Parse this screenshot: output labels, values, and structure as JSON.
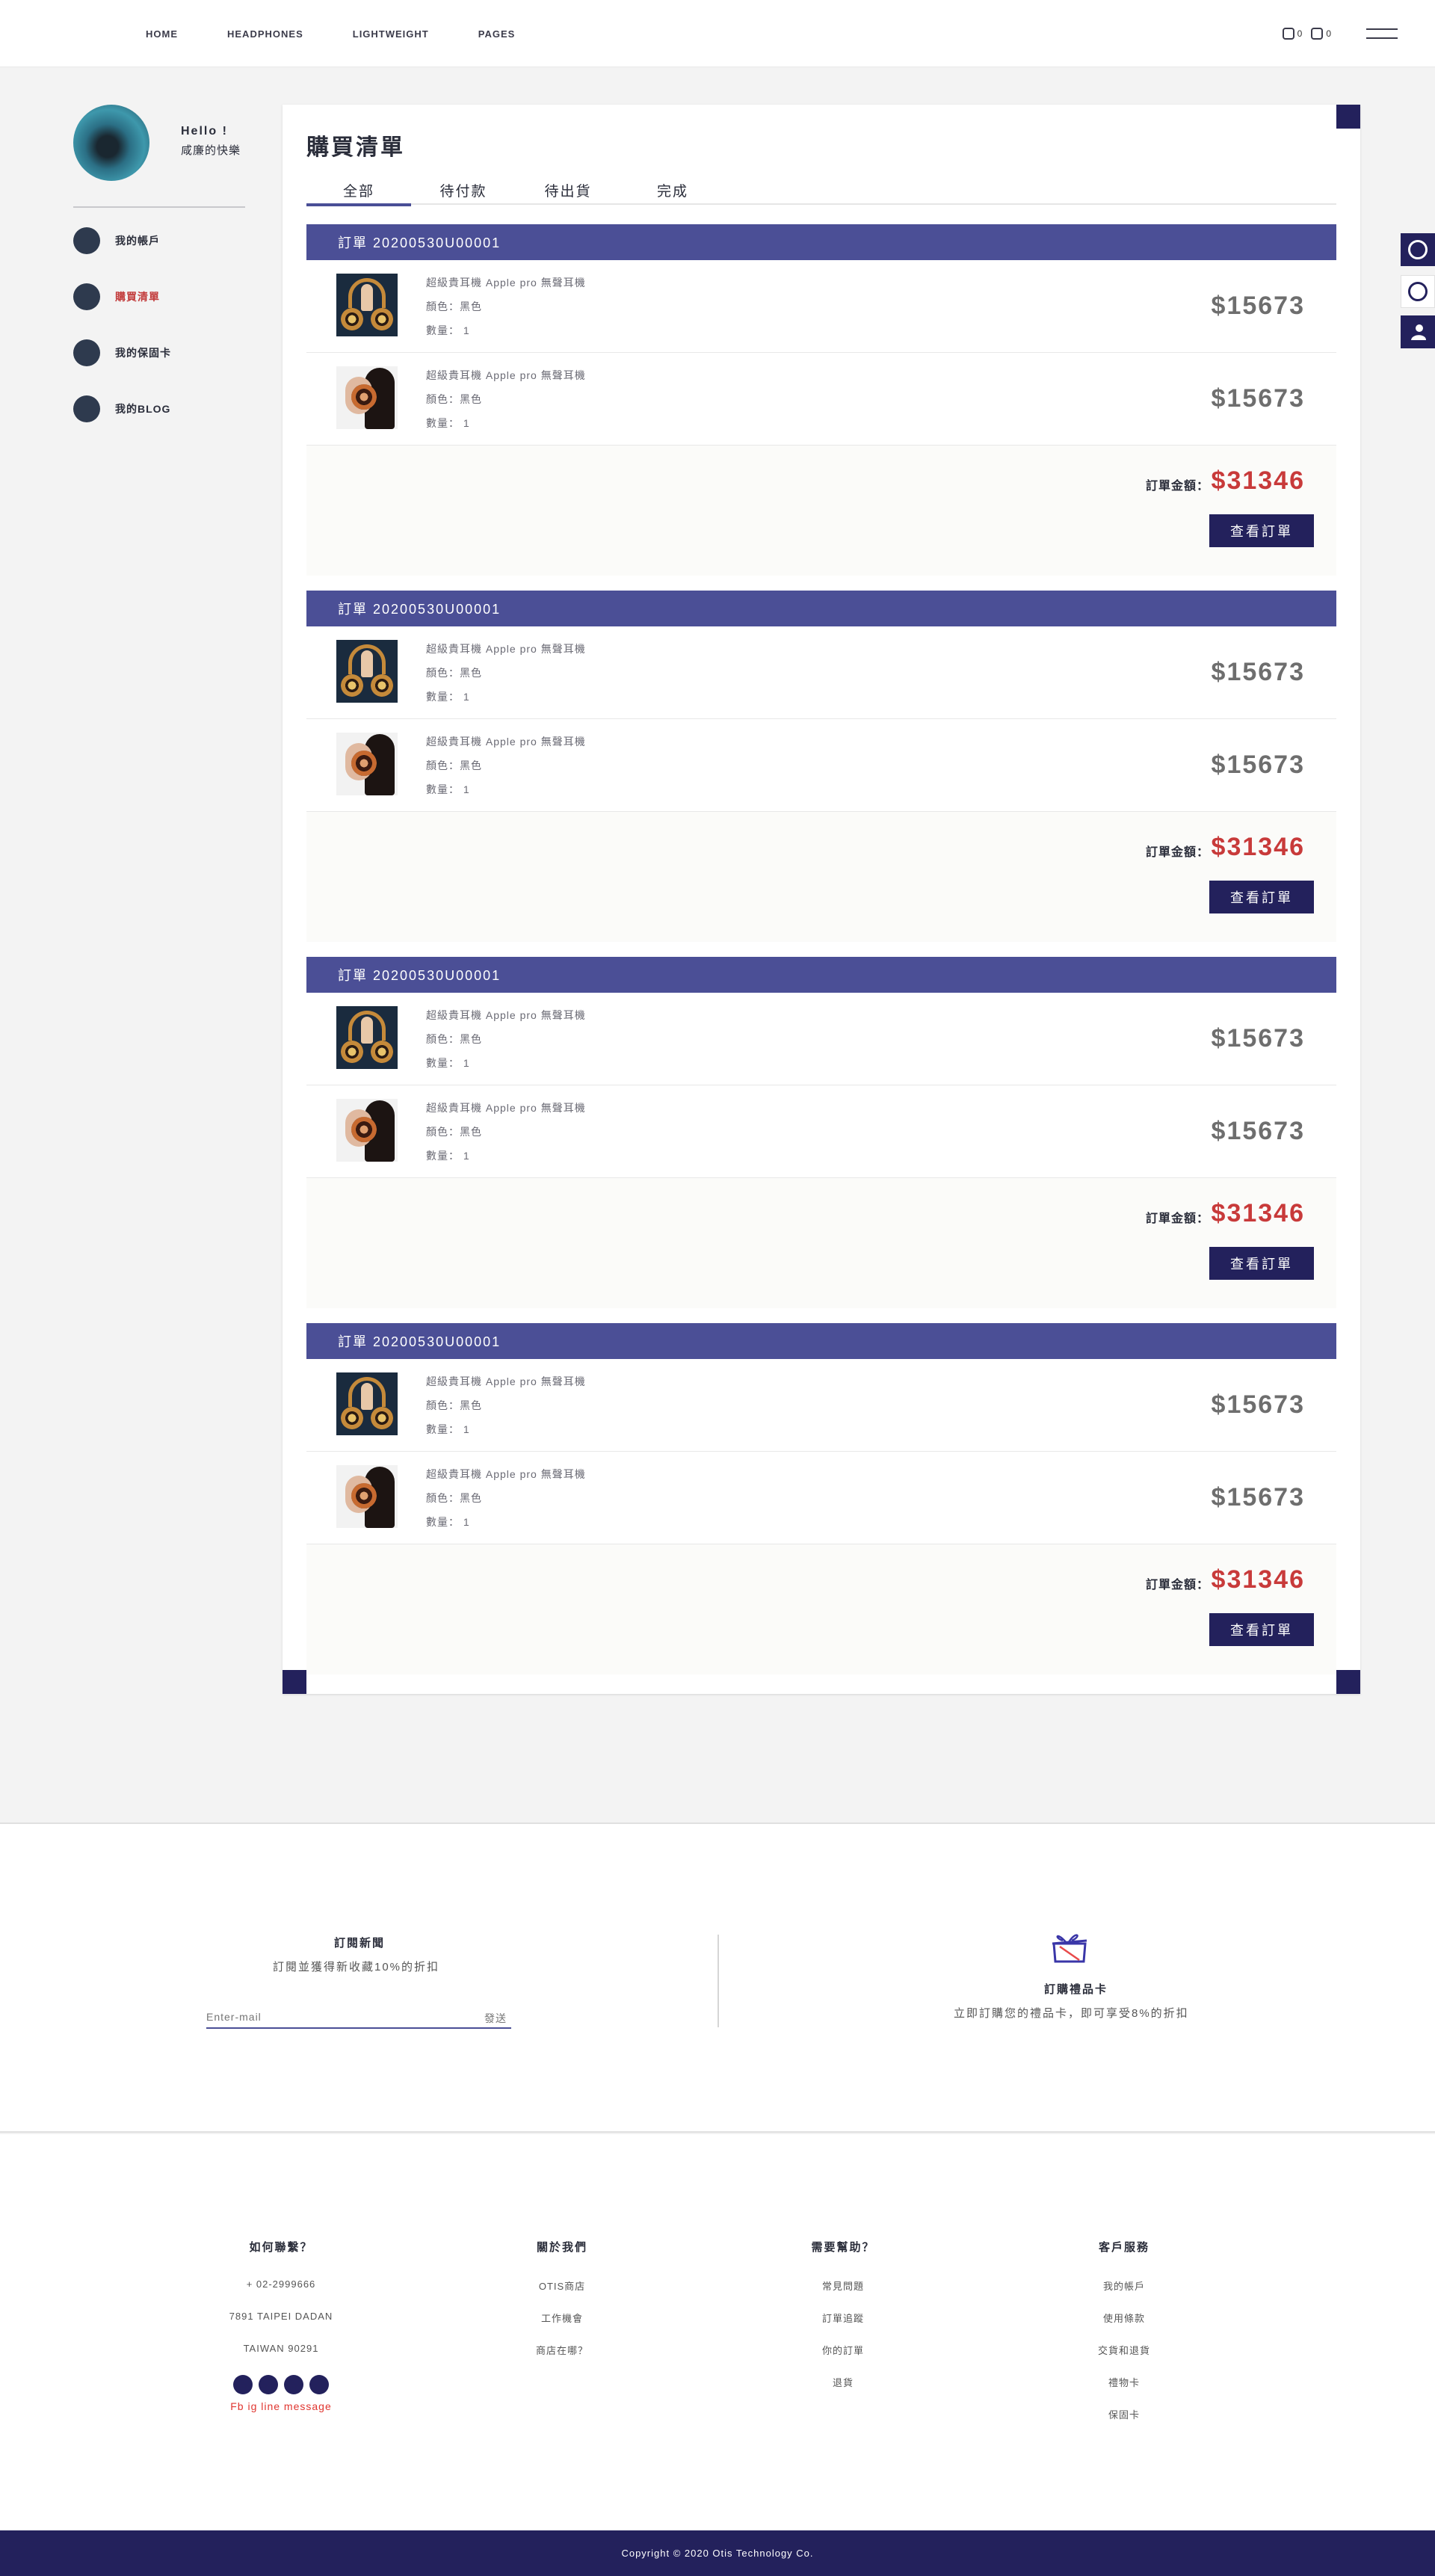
{
  "nav": {
    "links": [
      "HOME",
      "HEADPHONES",
      "LIGHTWEIGHT",
      "PAGES"
    ],
    "wishlist_count": "0",
    "cart_count": "0"
  },
  "sidebar": {
    "hello": "Hello !",
    "username": "咸廉的快樂",
    "items": [
      {
        "label": "我的帳戶",
        "active": false
      },
      {
        "label": "購買清單",
        "active": true
      },
      {
        "label": "我的保固卡",
        "active": false
      },
      {
        "label": "我的BLOG",
        "active": false
      }
    ]
  },
  "main": {
    "title": "購買清單",
    "tabs": [
      {
        "label": "全部",
        "active": true
      },
      {
        "label": "待付款",
        "active": false
      },
      {
        "label": "待出貨",
        "active": false
      },
      {
        "label": "完成",
        "active": false
      }
    ],
    "orders": [
      {
        "header": "訂單  20200530U00001",
        "items": [
          {
            "name": "超級貴耳機 Apple pro 無聲耳機",
            "color": "顏色：黑色",
            "qty": "數量： 1",
            "price": "$15673"
          },
          {
            "name": "超級貴耳機 Apple pro 無聲耳機",
            "color": "顏色：黑色",
            "qty": "數量： 1",
            "price": "$15673"
          }
        ],
        "total_label": "訂單金額：",
        "total": "$31346",
        "button": "查看訂單"
      },
      {
        "header": "訂單  20200530U00001",
        "items": [
          {
            "name": "超級貴耳機 Apple pro 無聲耳機",
            "color": "顏色：黑色",
            "qty": "數量： 1",
            "price": "$15673"
          },
          {
            "name": "超級貴耳機 Apple pro 無聲耳機",
            "color": "顏色：黑色",
            "qty": "數量： 1",
            "price": "$15673"
          }
        ],
        "total_label": "訂單金額：",
        "total": "$31346",
        "button": "查看訂單"
      },
      {
        "header": "訂單  20200530U00001",
        "items": [
          {
            "name": "超級貴耳機 Apple pro 無聲耳機",
            "color": "顏色：黑色",
            "qty": "數量： 1",
            "price": "$15673"
          },
          {
            "name": "超級貴耳機 Apple pro 無聲耳機",
            "color": "顏色：黑色",
            "qty": "數量： 1",
            "price": "$15673"
          }
        ],
        "total_label": "訂單金額：",
        "total": "$31346",
        "button": "查看訂單"
      },
      {
        "header": "訂單  20200530U00001",
        "items": [
          {
            "name": "超級貴耳機 Apple pro 無聲耳機",
            "color": "顏色：黑色",
            "qty": "數量： 1",
            "price": "$15673"
          },
          {
            "name": "超級貴耳機 Apple pro 無聲耳機",
            "color": "顏色：黑色",
            "qty": "數量： 1",
            "price": "$15673"
          }
        ],
        "total_label": "訂單金額：",
        "total": "$31346",
        "button": "查看訂單"
      }
    ]
  },
  "subscribe": {
    "title": "訂閱新聞",
    "text": "訂閱並獲得新收藏10%的折扣",
    "placeholder": "Enter-mail",
    "send": "發送"
  },
  "giftcard": {
    "title": "訂購禮品卡",
    "text": "立即訂購您的禮品卡，即可享受8%的折扣"
  },
  "footer": {
    "columns": [
      {
        "title": "如何聯繫？",
        "links": [
          "+ 02-2999666",
          "7891 TAIPEI DADAN",
          "TAIWAN 90291"
        ]
      },
      {
        "title": "關於我們",
        "links": [
          "OTIS商店",
          "工作機會",
          "商店在哪？"
        ]
      },
      {
        "title": "需要幫助？",
        "links": [
          "常見問題",
          "訂單追蹤",
          "你的訂單",
          "退貨"
        ]
      },
      {
        "title": "客戶服務",
        "links": [
          "我的帳戶",
          "使用條款",
          "交貨和退貨",
          "禮物卡",
          "保固卡"
        ]
      }
    ],
    "social_labels": "Fb ig line message",
    "copyright": "Copyright © 2020 Otis Technology Co."
  },
  "colors": {
    "brand_dark": "#23215c",
    "order_header": "#4b4f96",
    "accent_red": "#c83a3a"
  },
  "icons": [
    "wishlist-icon",
    "cart-icon",
    "menu-icon",
    "gift-box-icon",
    "message-icon",
    "chat-icon",
    "user-icon"
  ]
}
